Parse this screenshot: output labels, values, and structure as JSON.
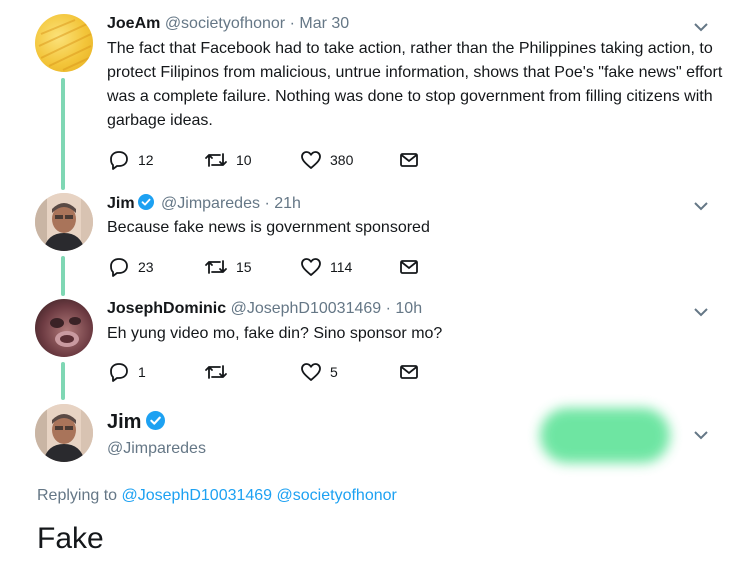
{
  "tweets": [
    {
      "name": "JoeAm",
      "handle": "@societyofhonor",
      "sep": "·",
      "time": "Mar 30",
      "text": "The fact that Facebook had to take action, rather than the Philippines taking action, to protect Filipinos from malicious, untrue information, shows that Poe's \"fake news\" effort was a complete failure. Nothing was done to stop government from filling citizens with garbage ideas.",
      "replies": "12",
      "retweets": "10",
      "likes": "380"
    },
    {
      "name": "Jim",
      "handle": "@Jimparedes",
      "sep": "·",
      "time": "21h",
      "text": "Because fake news is government sponsored",
      "replies": "23",
      "retweets": "15",
      "likes": "114"
    },
    {
      "name": "JosephDominic",
      "handle": "@JosephD10031469",
      "sep": "·",
      "time": "10h",
      "text": "Eh yung video mo, fake din? Sino sponsor mo?",
      "replies": "1",
      "retweets": "",
      "likes": "5"
    }
  ],
  "main_tweet": {
    "name": "Jim",
    "handle": "@Jimparedes",
    "replying_label": "Replying to",
    "mention1": "@JosephD10031469",
    "mention2": "@societyofhonor",
    "text": "Fake"
  },
  "colors": {
    "accent": "#1da1f2",
    "thread_line": "#7fd7b4",
    "verified": "#1da1f2",
    "blur": "#5fe399"
  },
  "icons": {
    "reply": "reply-icon",
    "retweet": "retweet-icon",
    "like": "heart-icon",
    "dm": "envelope-icon",
    "menu": "chevron-down-icon",
    "verified": "verified-badge-icon"
  }
}
